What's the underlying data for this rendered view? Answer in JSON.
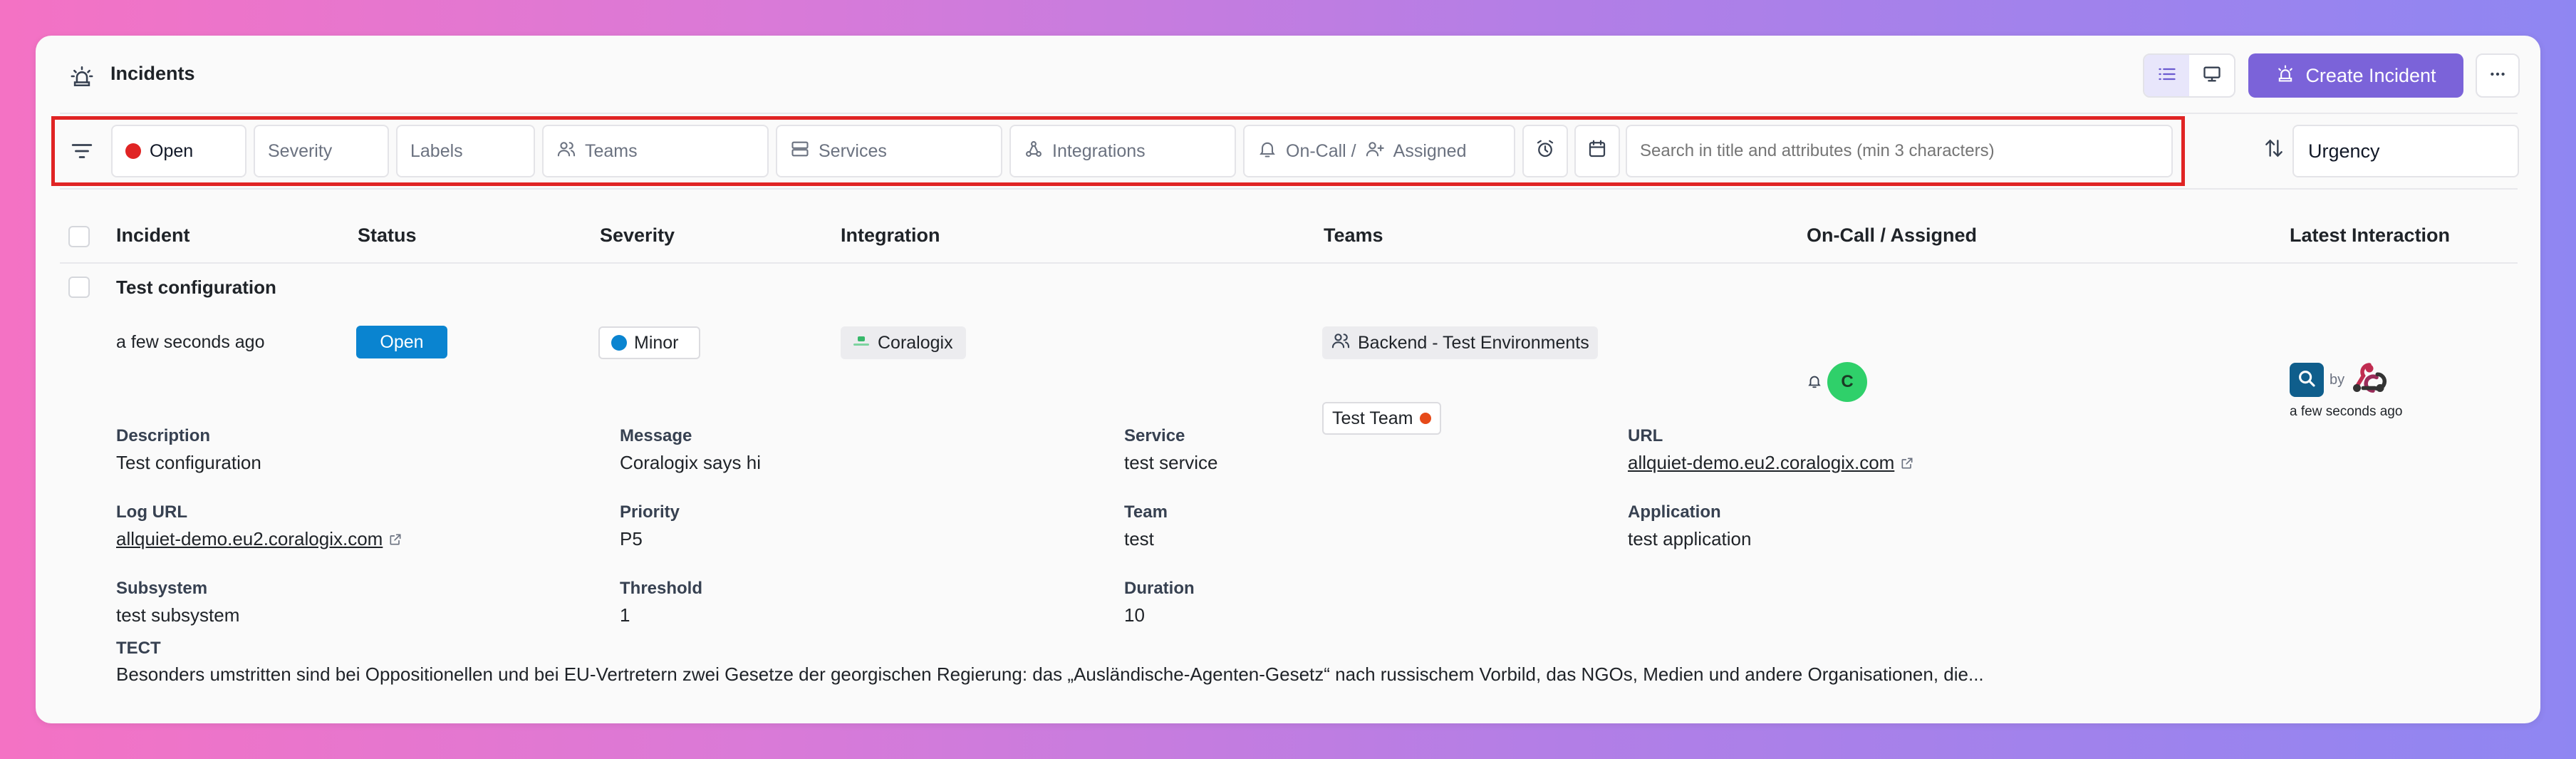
{
  "header": {
    "title": "Incidents",
    "create_label": "Create Incident"
  },
  "filters": {
    "status_label": "Open",
    "severity_label": "Severity",
    "labels_label": "Labels",
    "teams_label": "Teams",
    "services_label": "Services",
    "integrations_label": "Integrations",
    "oncall_label": "On-Call / ",
    "assigned_label": "Assigned",
    "search_placeholder": "Search in title and attributes (min 3 characters)",
    "sort_label": "Urgency"
  },
  "table": {
    "columns": {
      "incident": "Incident",
      "status": "Status",
      "severity": "Severity",
      "integration": "Integration",
      "teams": "Teams",
      "oncall": "On-Call / Assigned",
      "latest": "Latest Interaction"
    },
    "row": {
      "title": "Test configuration",
      "time": "a few seconds ago",
      "status": "Open",
      "severity": "Minor",
      "integration": "Coralogix",
      "team_1": "Backend - Test Environments",
      "team_2": "Test Team",
      "avatar_initial": "C",
      "by": "by",
      "latest_time": "a few seconds ago"
    }
  },
  "details": {
    "description_label": "Description",
    "description": "Test configuration",
    "message_label": "Message",
    "message": "Coralogix says hi",
    "service_label": "Service",
    "service": "test service",
    "url_label": "URL",
    "url": "allquiet-demo.eu2.coralogix.com",
    "log_url_label": "Log URL",
    "log_url": "allquiet-demo.eu2.coralogix.com",
    "priority_label": "Priority",
    "priority": "P5",
    "team_label": "Team",
    "team": "test",
    "application_label": "Application",
    "application": "test application",
    "subsystem_label": "Subsystem",
    "subsystem": "test subsystem",
    "threshold_label": "Threshold",
    "threshold": "1",
    "duration_label": "Duration",
    "duration": "10",
    "tect_label": "TECT",
    "tect": "Besonders umstritten sind bei Oppositionellen und bei EU-Vertretern zwei Gesetze der georgischen Regierung: das „Ausländische-Agenten-Gesetz“ nach russischem Vorbild, das NGOs, Medien und andere Organisationen, die..."
  },
  "colors": {
    "accent": "#7b63d9",
    "status_open": "#0a84d0",
    "filter_highlight": "#e02424",
    "avatar": "#2fd06a"
  },
  "icons": [
    "incident-siren-icon",
    "list-view-icon",
    "monitor-icon",
    "more-icon",
    "filter-icon",
    "teams-icon",
    "services-icon",
    "integrations-icon",
    "bell-icon",
    "user-plus-icon",
    "alarm-clock-icon",
    "calendar-icon",
    "sort-icon",
    "coralogix-icon",
    "search-icon",
    "webhook-icon",
    "external-link-icon"
  ]
}
